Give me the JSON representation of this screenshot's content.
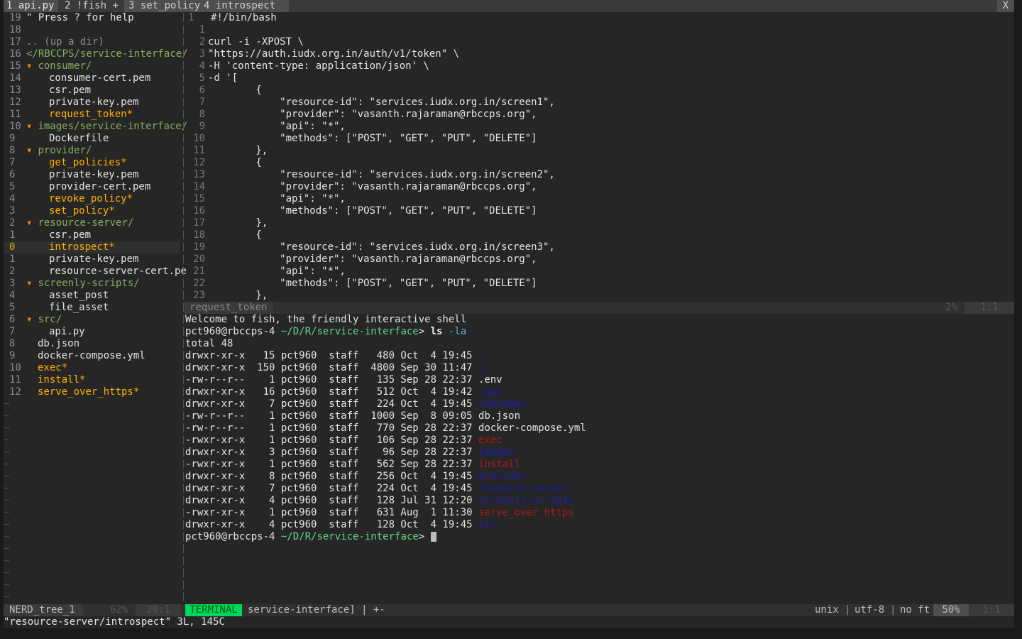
{
  "tabs": [
    {
      "label": "1 api.py"
    },
    {
      "label": "2 !fish +"
    },
    {
      "label": "3 set_policy"
    },
    {
      "label": "4 introspect"
    }
  ],
  "tab_close": "X",
  "nerdtree": {
    "help": "\" Press ? for help",
    "updir": ".. (up a dir)",
    "root": "</RBCCPS/service-interface/",
    "rows": [
      {
        "ln": "19",
        "kind": "help",
        "text": "\" Press ? for help"
      },
      {
        "ln": "18",
        "kind": "blank",
        "text": ""
      },
      {
        "ln": "17",
        "kind": "updir",
        "text": ".. (up a dir)"
      },
      {
        "ln": "16",
        "kind": "root",
        "text": "</RBCCPS/service-interface/"
      },
      {
        "ln": "15",
        "kind": "dir",
        "indent": 1,
        "text": "consumer/"
      },
      {
        "ln": "14",
        "kind": "file",
        "indent": 2,
        "text": "consumer-cert.pem"
      },
      {
        "ln": "13",
        "kind": "file",
        "indent": 2,
        "text": "csr.pem"
      },
      {
        "ln": "12",
        "kind": "file",
        "indent": 2,
        "text": "private-key.pem"
      },
      {
        "ln": "11",
        "kind": "exe",
        "indent": 2,
        "text": "request_token*"
      },
      {
        "ln": "10",
        "kind": "dir",
        "indent": 1,
        "text": "images/service-interface/"
      },
      {
        "ln": "9",
        "kind": "file",
        "indent": 2,
        "text": "Dockerfile"
      },
      {
        "ln": "8",
        "kind": "dir",
        "indent": 1,
        "text": "provider/"
      },
      {
        "ln": "7",
        "kind": "exe",
        "indent": 2,
        "text": "get_policies*"
      },
      {
        "ln": "6",
        "kind": "file",
        "indent": 2,
        "text": "private-key.pem"
      },
      {
        "ln": "5",
        "kind": "file",
        "indent": 2,
        "text": "provider-cert.pem"
      },
      {
        "ln": "4",
        "kind": "exe",
        "indent": 2,
        "text": "revoke_policy*"
      },
      {
        "ln": "3",
        "kind": "exe",
        "indent": 2,
        "text": "set_policy*"
      },
      {
        "ln": "2",
        "kind": "dir",
        "indent": 1,
        "text": "resource-server/"
      },
      {
        "ln": "1",
        "kind": "file",
        "indent": 2,
        "text": "csr.pem"
      },
      {
        "ln": "0",
        "kind": "exe",
        "indent": 2,
        "text": "introspect*",
        "current": true
      },
      {
        "ln": "1",
        "kind": "file",
        "indent": 2,
        "text": "private-key.pem"
      },
      {
        "ln": "2",
        "kind": "file",
        "indent": 2,
        "text": "resource-server-cert.pe"
      },
      {
        "ln": "3",
        "kind": "dir",
        "indent": 1,
        "text": "screenly-scripts/"
      },
      {
        "ln": "4",
        "kind": "file",
        "indent": 2,
        "text": "asset_post"
      },
      {
        "ln": "5",
        "kind": "file",
        "indent": 2,
        "text": "file_asset"
      },
      {
        "ln": "6",
        "kind": "dir",
        "indent": 1,
        "text": "src/"
      },
      {
        "ln": "7",
        "kind": "file",
        "indent": 2,
        "text": "api.py"
      },
      {
        "ln": "8",
        "kind": "file",
        "indent": 1,
        "text": "db.json"
      },
      {
        "ln": "9",
        "kind": "file",
        "indent": 1,
        "text": "docker-compose.yml"
      },
      {
        "ln": "10",
        "kind": "exe",
        "indent": 1,
        "text": "exec*"
      },
      {
        "ln": "11",
        "kind": "exe",
        "indent": 1,
        "text": "install*"
      },
      {
        "ln": "12",
        "kind": "exe",
        "indent": 1,
        "text": "serve_over_https*"
      }
    ]
  },
  "editor": {
    "filename": "request_token",
    "percent": "2%",
    "position": "1:1",
    "lines": [
      {
        "ln": "1",
        "text": "#!/bin/bash",
        "style": "cm",
        "current": true
      },
      {
        "ln": "1",
        "text": "",
        "style": "n"
      },
      {
        "ln": "2",
        "text": "curl -i -XPOST \\",
        "style": "curl"
      },
      {
        "ln": "3",
        "text": "\"https://auth.iudx.org.in/auth/v1/token\" \\",
        "style": "s"
      },
      {
        "ln": "4",
        "text": "-H 'content-type: application/json' \\",
        "style": "h"
      },
      {
        "ln": "5",
        "text": "-d '[",
        "style": "d"
      },
      {
        "ln": "6",
        "text": "        {",
        "style": "s"
      },
      {
        "ln": "7",
        "text": "            \"resource-id\": \"services.iudx.org.in/screen1\",",
        "style": "s"
      },
      {
        "ln": "8",
        "text": "            \"provider\": \"vasanth.rajaraman@rbccps.org\",",
        "style": "s"
      },
      {
        "ln": "9",
        "text": "            \"api\": \"*\",",
        "style": "s"
      },
      {
        "ln": "10",
        "text": "            \"methods\": [\"POST\", \"GET\", \"PUT\", \"DELETE\"]",
        "style": "s"
      },
      {
        "ln": "11",
        "text": "        },",
        "style": "s"
      },
      {
        "ln": "12",
        "text": "        {",
        "style": "s"
      },
      {
        "ln": "13",
        "text": "            \"resource-id\": \"services.iudx.org.in/screen2\",",
        "style": "s"
      },
      {
        "ln": "14",
        "text": "            \"provider\": \"vasanth.rajaraman@rbccps.org\",",
        "style": "s"
      },
      {
        "ln": "15",
        "text": "            \"api\": \"*\",",
        "style": "s"
      },
      {
        "ln": "16",
        "text": "            \"methods\": [\"POST\", \"GET\", \"PUT\", \"DELETE\"]",
        "style": "s"
      },
      {
        "ln": "17",
        "text": "        },",
        "style": "s"
      },
      {
        "ln": "18",
        "text": "        {",
        "style": "s"
      },
      {
        "ln": "19",
        "text": "            \"resource-id\": \"services.iudx.org.in/screen3\",",
        "style": "s"
      },
      {
        "ln": "20",
        "text": "            \"provider\": \"vasanth.rajaraman@rbccps.org\",",
        "style": "s"
      },
      {
        "ln": "21",
        "text": "            \"api\": \"*\",",
        "style": "s"
      },
      {
        "ln": "22",
        "text": "            \"methods\": [\"POST\", \"GET\", \"PUT\", \"DELETE\"]",
        "style": "s"
      },
      {
        "ln": "23",
        "text": "        },",
        "style": "s"
      }
    ]
  },
  "terminal": {
    "welcome": "Welcome to fish, the friendly interactive shell",
    "prompt_user": "pct960@rbccps-4",
    "prompt_path": "~/D/R/service-interface",
    "prompt_sym": ">",
    "command": "ls",
    "command_arg": "-la",
    "total": "total 48",
    "listing": [
      {
        "meta": "drwxr-xr-x   15 pct960  staff   480 Oct  4 19:45",
        "name": ".",
        "type": "dir"
      },
      {
        "meta": "drwxr-xr-x  150 pct960  staff  4800 Sep 30 11:47",
        "name": "..",
        "type": "dir"
      },
      {
        "meta": "-rw-r--r--    1 pct960  staff   135 Sep 28 22:37",
        "name": ".env",
        "type": "file"
      },
      {
        "meta": "drwxr-xr-x   16 pct960  staff   512 Oct  4 19:42",
        "name": ".git",
        "type": "dir"
      },
      {
        "meta": "drwxr-xr-x    7 pct960  staff   224 Oct  4 19:45",
        "name": "consumer",
        "type": "dir"
      },
      {
        "meta": "-rw-r--r--    1 pct960  staff  1000 Sep  8 09:05",
        "name": "db.json",
        "type": "file"
      },
      {
        "meta": "-rw-r--r--    1 pct960  staff   770 Sep 28 22:37",
        "name": "docker-compose.yml",
        "type": "file"
      },
      {
        "meta": "-rwxr-xr-x    1 pct960  staff   106 Sep 28 22:37",
        "name": "exec",
        "type": "exe"
      },
      {
        "meta": "drwxr-xr-x    3 pct960  staff    96 Sep 28 22:37",
        "name": "images",
        "type": "dir"
      },
      {
        "meta": "-rwxr-xr-x    1 pct960  staff   562 Sep 28 22:37",
        "name": "install",
        "type": "exe"
      },
      {
        "meta": "drwxr-xr-x    8 pct960  staff   256 Oct  4 19:45",
        "name": "provider",
        "type": "dir"
      },
      {
        "meta": "drwxr-xr-x    7 pct960  staff   224 Oct  4 19:45",
        "name": "resource-server",
        "type": "dir"
      },
      {
        "meta": "drwxr-xr-x    4 pct960  staff   128 Jul 31 12:20",
        "name": "screenly-scripts",
        "type": "dir"
      },
      {
        "meta": "-rwxr-xr-x    1 pct960  staff   631 Aug  1 11:30",
        "name": "serve_over_https",
        "type": "exe"
      },
      {
        "meta": "drwxr-xr-x    4 pct960  staff   128 Oct  4 19:45",
        "name": "src",
        "type": "dir"
      }
    ]
  },
  "statusbar": {
    "nerd_name": "NERD_tree_1",
    "nerd_pct": "62%",
    "nerd_pos": "20:1",
    "mode": "TERMINAL",
    "term_name": "service-interface] | +-",
    "fileformat": "unix",
    "encoding": "utf-8",
    "filetype": "no ft",
    "pct": "50%",
    "pos": "1:1"
  },
  "cmdline": "\"resource-server/introspect\" 3L, 145C",
  "colors": {
    "background": "#262626",
    "mode_terminal": "#00d75f",
    "dir": "#87af5f",
    "exe": "#ffaf00",
    "string": "#d7d787",
    "ls_dir": "#1c1cb0",
    "ls_exe": "#b01818"
  }
}
